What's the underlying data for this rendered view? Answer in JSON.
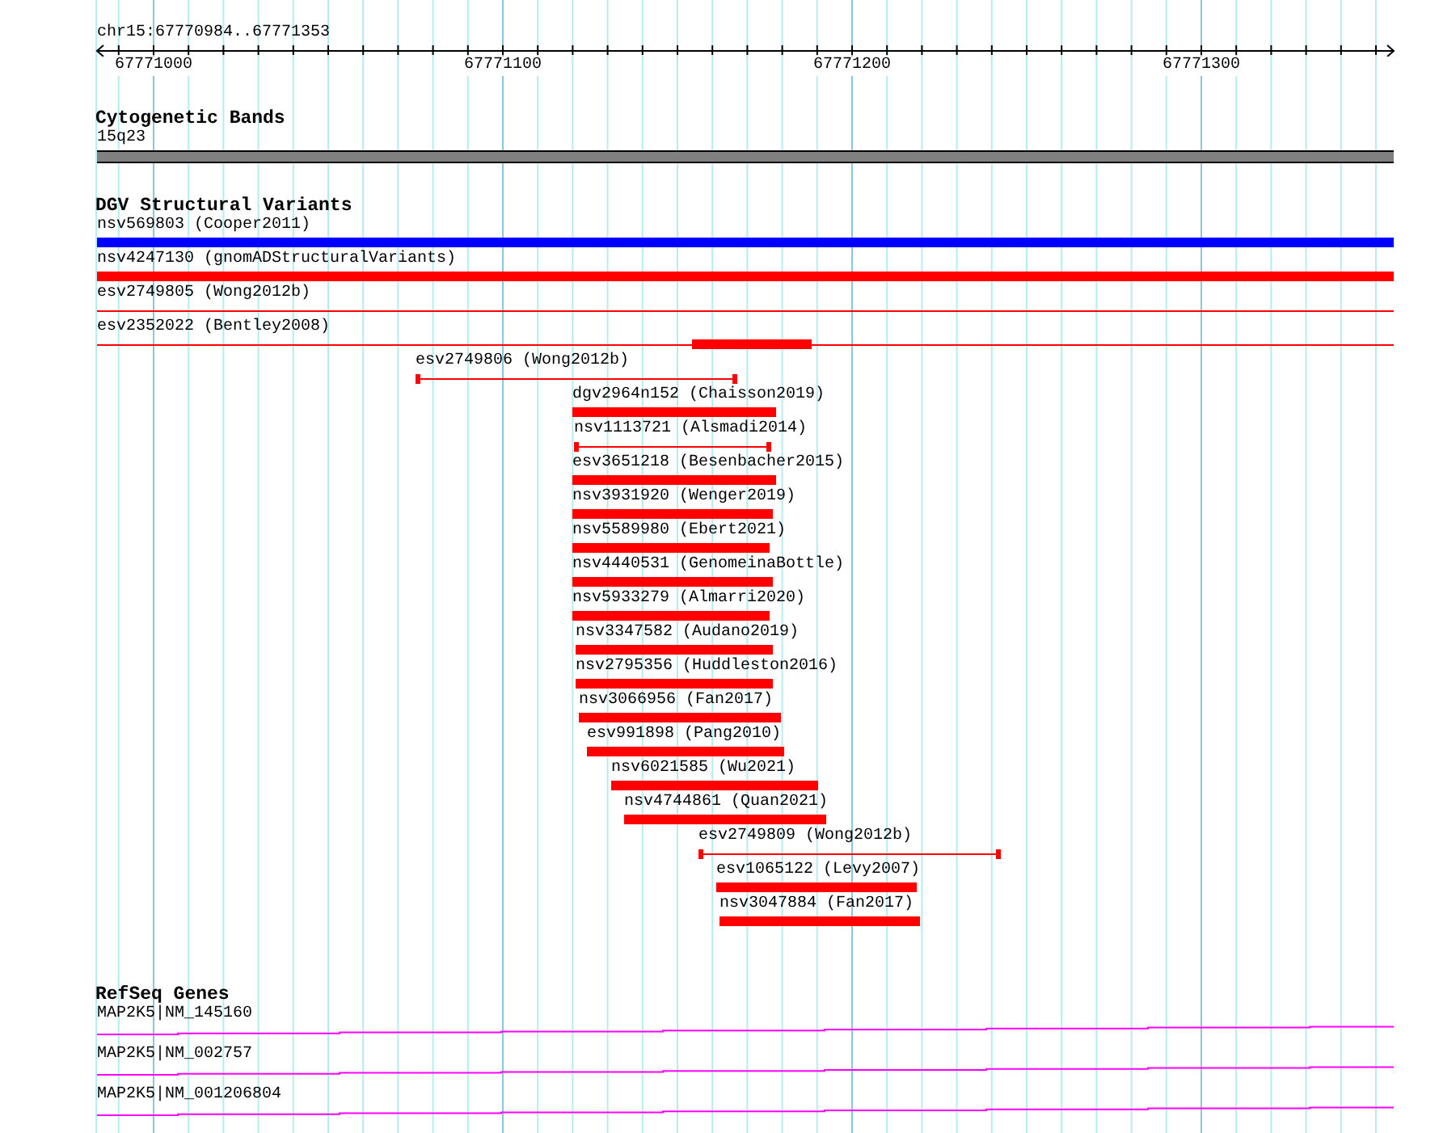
{
  "ruler": {
    "location": "chr15:67770984..67771353",
    "ticks": [
      "67771000",
      "67771100",
      "67771200",
      "67771300"
    ]
  },
  "tracks": [
    {
      "title": "Cytogenetic Bands",
      "kind": "band",
      "features": [
        {
          "label": "15q23"
        }
      ]
    },
    {
      "title": "DGV Structural Variants",
      "kind": "variants",
      "features": [
        {
          "label": "nsv569803 (Cooper2011)",
          "kind": "bar",
          "color": "#0000ff"
        },
        {
          "label": "nsv4247130 (gnomADStructuralVariants)",
          "kind": "bar",
          "color": "#ff0000"
        },
        {
          "label": "esv2749805 (Wong2012b)",
          "kind": "line",
          "color": "#ff0000"
        },
        {
          "label": "esv2352022 (Bentley2008)",
          "kind": "line-block",
          "color": "#ff0000"
        },
        {
          "label": "esv2749806 (Wong2012b)",
          "kind": "capped",
          "color": "#ff0000"
        },
        {
          "label": "dgv2964n152 (Chaisson2019)",
          "kind": "bar",
          "color": "#ff0000"
        },
        {
          "label": "nsv1113721 (Alsmadi2014)",
          "kind": "capped",
          "color": "#ff0000"
        },
        {
          "label": "esv3651218 (Besenbacher2015)",
          "kind": "bar",
          "color": "#ff0000"
        },
        {
          "label": "nsv3931920 (Wenger2019)",
          "kind": "bar",
          "color": "#ff0000"
        },
        {
          "label": "nsv5589980 (Ebert2021)",
          "kind": "bar",
          "color": "#ff0000"
        },
        {
          "label": "nsv4440531 (GenomeinaBottle)",
          "kind": "bar",
          "color": "#ff0000"
        },
        {
          "label": "nsv5933279 (Almarri2020)",
          "kind": "bar",
          "color": "#ff0000"
        },
        {
          "label": "nsv3347582 (Audano2019)",
          "kind": "bar",
          "color": "#ff0000"
        },
        {
          "label": "nsv2795356 (Huddleston2016)",
          "kind": "bar",
          "color": "#ff0000"
        },
        {
          "label": "nsv3066956 (Fan2017)",
          "kind": "bar",
          "color": "#ff0000"
        },
        {
          "label": "esv991898 (Pang2010)",
          "kind": "bar",
          "color": "#ff0000"
        },
        {
          "label": "nsv6021585 (Wu2021)",
          "kind": "bar",
          "color": "#ff0000"
        },
        {
          "label": "nsv4744861 (Quan2021)",
          "kind": "bar",
          "color": "#ff0000"
        },
        {
          "label": "esv2749809 (Wong2012b)",
          "kind": "capped",
          "color": "#ff0000"
        },
        {
          "label": "esv1065122 (Levy2007)",
          "kind": "bar",
          "color": "#ff0000"
        },
        {
          "label": "nsv3047884 (Fan2017)",
          "kind": "bar",
          "color": "#ff0000"
        }
      ]
    },
    {
      "title": "RefSeq Genes",
      "kind": "genes",
      "features": [
        {
          "label": "MAP2K5|NM_145160"
        },
        {
          "label": "MAP2K5|NM_002757"
        },
        {
          "label": "MAP2K5|NM_001206804"
        }
      ]
    }
  ]
}
